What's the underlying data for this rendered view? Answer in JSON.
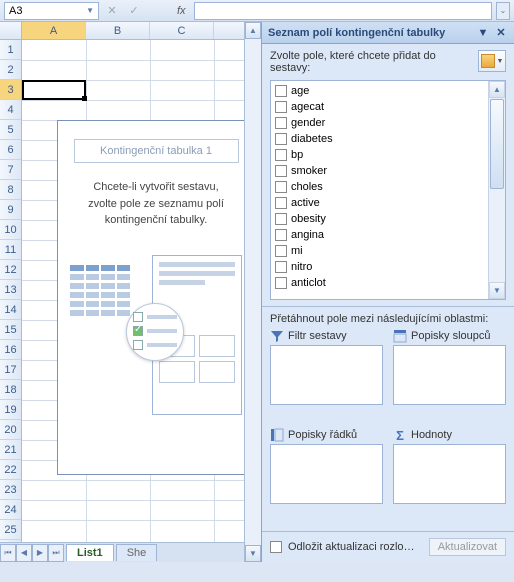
{
  "formula_bar": {
    "cell_ref": "A3",
    "fx_label": "fx"
  },
  "columns": [
    "A",
    "B",
    "C"
  ],
  "rows": [
    "1",
    "2",
    "3",
    "4",
    "5",
    "6",
    "7",
    "8",
    "9",
    "10",
    "11",
    "12",
    "13",
    "14",
    "15",
    "16",
    "17",
    "18",
    "19",
    "20",
    "21",
    "22",
    "23",
    "24",
    "25"
  ],
  "active_cell": "A3",
  "pivot_placeholder": {
    "title": "Kontingenční tabulka 1",
    "message_l1": "Chcete-li vytvořit sestavu,",
    "message_l2": "zvolte pole ze seznamu polí",
    "message_l3": "kontingenční tabulky."
  },
  "sheet_tabs": {
    "active": "List1",
    "next_partial": "She"
  },
  "task_pane": {
    "title": "Seznam polí kontingenční tabulky",
    "instruction": "Zvolte pole, které chcete přidat do sestavy:",
    "fields": [
      "age",
      "agecat",
      "gender",
      "diabetes",
      "bp",
      "smoker",
      "choles",
      "active",
      "obesity",
      "angina",
      "mi",
      "nitro",
      "anticlot"
    ],
    "drag_label": "Přetáhnout pole mezi následujícími oblastmi:",
    "areas": {
      "filter": "Filtr sestavy",
      "cols": "Popisky sloupců",
      "rows": "Popisky řádků",
      "vals": "Hodnoty"
    },
    "defer_label": "Odložit aktualizaci rozlo…",
    "update_btn": "Aktualizovat"
  }
}
